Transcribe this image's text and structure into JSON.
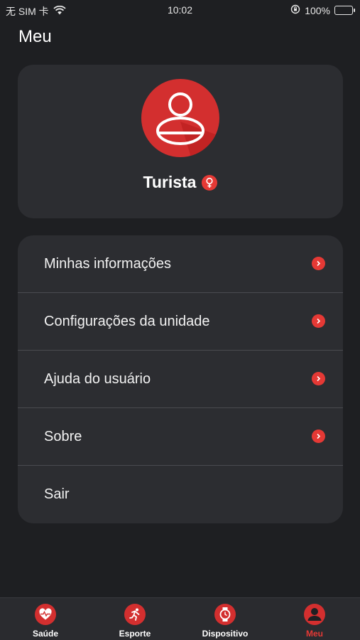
{
  "status_bar": {
    "carrier": "无 SIM 卡",
    "time": "10:02",
    "battery_percent": "100%",
    "battery_level": 1.0
  },
  "page": {
    "title": "Meu"
  },
  "profile": {
    "name": "Turista",
    "gender_icon": "female-icon"
  },
  "menu": {
    "items": [
      {
        "label": "Minhas informações",
        "has_chevron": true
      },
      {
        "label": "Configurações da unidade",
        "has_chevron": true
      },
      {
        "label": "Ajuda do usuário",
        "has_chevron": true
      },
      {
        "label": "Sobre",
        "has_chevron": true
      },
      {
        "label": "Sair",
        "has_chevron": false
      }
    ]
  },
  "tab_bar": {
    "tabs": [
      {
        "label": "Saúde",
        "icon": "heart-pulse-icon"
      },
      {
        "label": "Esporte",
        "icon": "runner-icon"
      },
      {
        "label": "Dispositivo",
        "icon": "watch-icon"
      },
      {
        "label": "Meu",
        "icon": "user-icon",
        "active": true
      }
    ]
  },
  "colors": {
    "accent": "#e53935",
    "background": "#1e1f22",
    "card": "#2c2d31"
  }
}
